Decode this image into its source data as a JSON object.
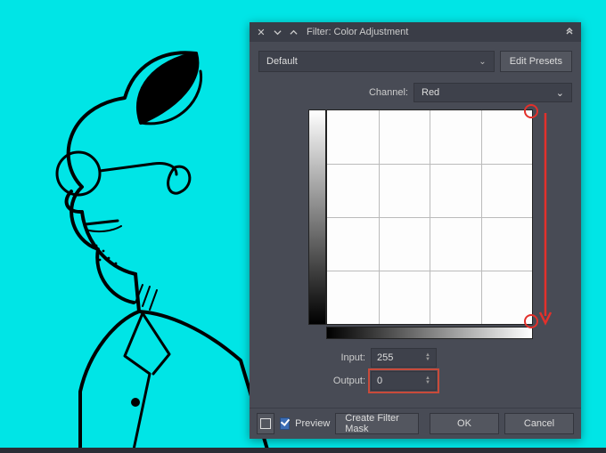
{
  "dialog": {
    "title": "Filter: Color Adjustment",
    "preset": {
      "selected": "Default",
      "edit_label": "Edit Presets"
    },
    "channel": {
      "label": "Channel:",
      "selected": "Red"
    },
    "input": {
      "label": "Input:",
      "value": "255"
    },
    "output": {
      "label": "Output:",
      "value": "0"
    },
    "footer": {
      "preview_label": "Preview",
      "create_mask_label": "Create Filter Mask",
      "ok_label": "OK",
      "cancel_label": "Cancel"
    }
  },
  "annotation": {
    "handle_top": true,
    "handle_bottom": true,
    "arrow": "down",
    "highlight_output": true,
    "color": "#e3302b"
  }
}
